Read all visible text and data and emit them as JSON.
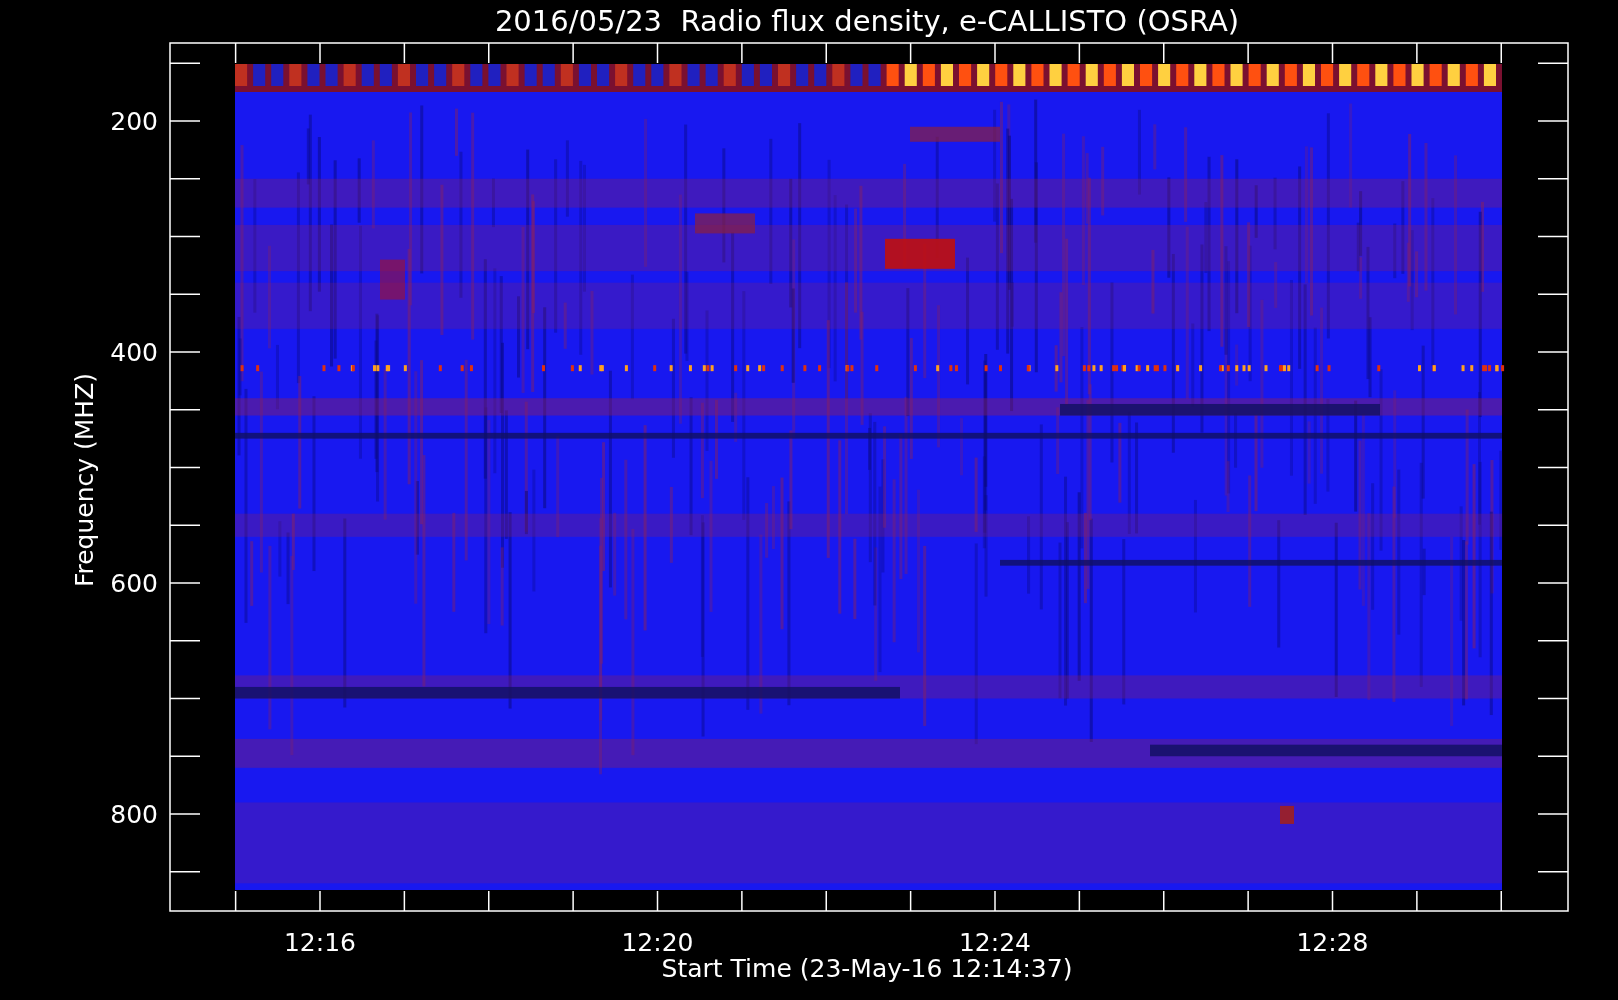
{
  "chart": {
    "title": "2016/05/23  Radio flux density, e-CALLISTO (OSRA)",
    "ylabel": "Frequency (MHZ)",
    "xlabel": "Start Time (23-May-16 12:14:37)",
    "yticks": [
      {
        "label": "200"
      },
      {
        "label": "400"
      },
      {
        "label": "600"
      },
      {
        "label": "800"
      }
    ],
    "xticks": [
      {
        "label": "12:16"
      },
      {
        "label": "12:20"
      },
      {
        "label": "12:24"
      },
      {
        "label": "12:28"
      }
    ]
  }
}
